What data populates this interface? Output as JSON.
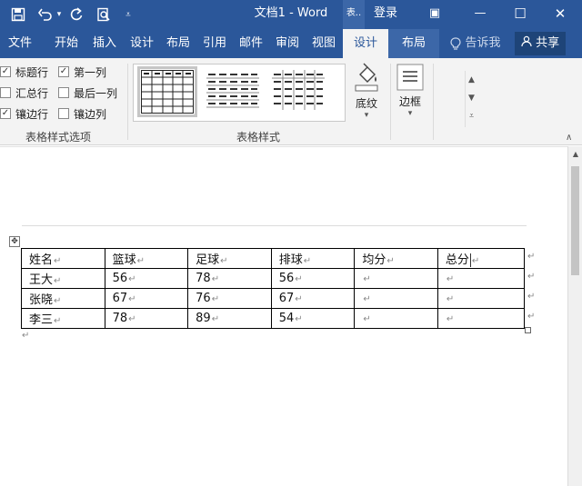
{
  "titlebar": {
    "quick_access": [
      {
        "icon": "save-icon",
        "glyph": "💾"
      },
      {
        "icon": "undo-icon",
        "glyph": "↶"
      },
      {
        "icon": "undo-dropdown-icon",
        "glyph": "▾"
      },
      {
        "icon": "redo-icon",
        "glyph": "↻"
      },
      {
        "icon": "print-preview-icon",
        "glyph": "🔍"
      },
      {
        "icon": "customize-toolbar-icon",
        "glyph": "⩡"
      }
    ],
    "title": "文档1  -  Word",
    "context_chip": "表..",
    "login": "登录",
    "ribbon_display_glyph": "▣",
    "minimize_glyph": "—",
    "maximize_glyph": "☐",
    "close_glyph": "✕"
  },
  "tabs": [
    "文件",
    "开始",
    "插入",
    "设计",
    "布局",
    "引用",
    "邮件",
    "审阅",
    "视图",
    "设计",
    "布局"
  ],
  "tell_me": "告诉我",
  "share": "共享",
  "ribbon": {
    "options": [
      {
        "label": "标题行",
        "checked": true
      },
      {
        "label": "第一列",
        "checked": true
      },
      {
        "label": "汇总行",
        "checked": false
      },
      {
        "label": "最后一列",
        "checked": false
      },
      {
        "label": "镶边行",
        "checked": true
      },
      {
        "label": "镶边列",
        "checked": false
      }
    ],
    "group_style_options": "表格样式选项",
    "group_table_styles": "表格样式",
    "shading": "底纹",
    "borders": "边框",
    "check_glyph": "✓",
    "dropdown_glyph": "▾"
  },
  "table": {
    "header": [
      "姓名",
      "篮球",
      "足球",
      "排球",
      "均分",
      "总分"
    ],
    "rows": [
      [
        "王大",
        "56",
        "78",
        "56",
        "",
        ""
      ],
      [
        "张晓",
        "67",
        "76",
        "67",
        "",
        ""
      ],
      [
        "李三",
        "78",
        "89",
        "54",
        "",
        ""
      ]
    ],
    "cell_mark": "↵",
    "move_glyph": "✥"
  },
  "colors": {
    "word_blue": "#2b579a",
    "ribbon_bg": "#f3f3f3",
    "share_bg": "#1e4478"
  }
}
